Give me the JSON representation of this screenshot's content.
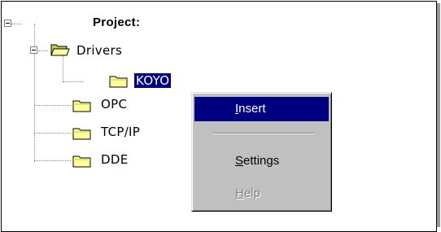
{
  "tree": {
    "root": {
      "label": "Project:"
    },
    "nodes": [
      {
        "id": "drivers",
        "label": "Drivers"
      },
      {
        "id": "koyo",
        "label": "KOYO",
        "selected": true
      },
      {
        "id": "opc",
        "label": "OPC"
      },
      {
        "id": "tcpip",
        "label": "TCP/IP"
      },
      {
        "id": "dde",
        "label": "DDE"
      }
    ]
  },
  "context_menu": {
    "items": [
      {
        "label": "Insert",
        "mnemonic": "I",
        "rest": "nsert",
        "highlighted": true
      },
      {
        "label": "Settings",
        "mnemonic": "S",
        "rest": "ettings"
      },
      {
        "label": "Help",
        "mnemonic": "H",
        "rest": "elp",
        "disabled": true
      }
    ]
  },
  "colors": {
    "selection": "#000080",
    "menu_background": "#c0c0c0",
    "folder_yellow": "#ffff99",
    "disabled_text": "#808080"
  }
}
